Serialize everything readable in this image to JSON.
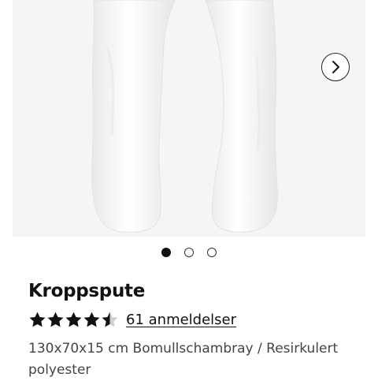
{
  "product": {
    "title": "Kroppspute",
    "rating": 4.5,
    "rating_max": 5,
    "reviews_label": "61 anmeldelser",
    "description": "130x70x15 cm Bomullschambray / Resirkulert polyester"
  },
  "gallery": {
    "image_count": 3,
    "active_index": 0,
    "next_icon": "chevron-right-icon"
  },
  "colors": {
    "star": "#111111",
    "text": "#111111",
    "image_background": "#f5f5f5"
  }
}
